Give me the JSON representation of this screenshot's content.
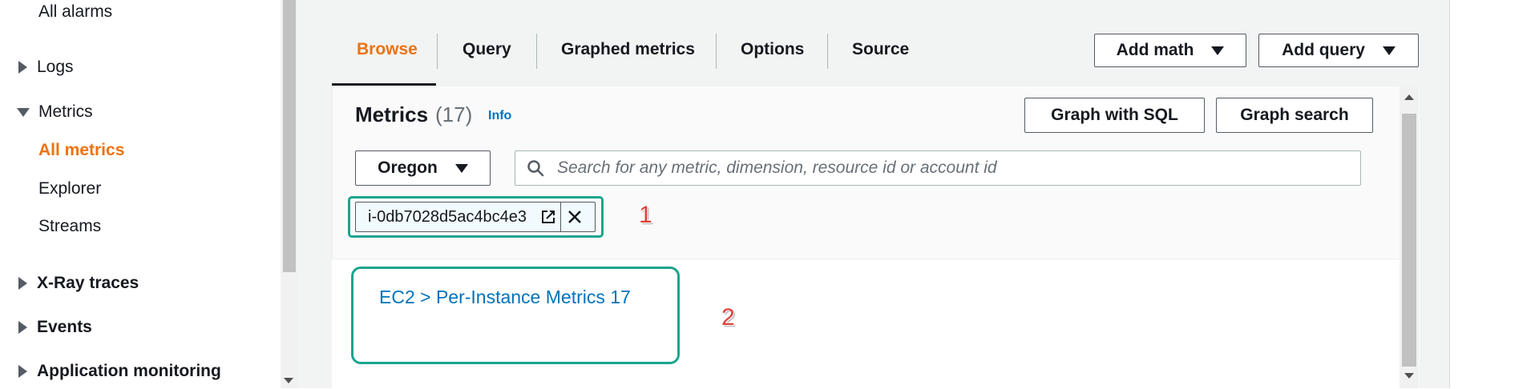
{
  "sidebar": {
    "all_alarms": "All alarms",
    "logs": "Logs",
    "metrics": "Metrics",
    "all_metrics": "All metrics",
    "explorer": "Explorer",
    "streams": "Streams",
    "xray": "X-Ray traces",
    "events": "Events",
    "app_monitoring": "Application monitoring"
  },
  "tabs": {
    "browse": "Browse",
    "query": "Query",
    "graphed": "Graphed metrics",
    "options": "Options",
    "source": "Source"
  },
  "toolbar": {
    "add_math": "Add math",
    "add_query": "Add query"
  },
  "metrics_panel": {
    "title": "Metrics",
    "count": "(17)",
    "info": "Info",
    "graph_sql": "Graph with SQL",
    "graph_search": "Graph search",
    "region": "Oregon",
    "search_placeholder": "Search for any metric, dimension, resource id or account id",
    "token": "i-0db7028d5ac4bc4e3",
    "result": "EC2 > Per-Instance Metrics 17"
  },
  "annotations": {
    "one": "1",
    "two": "2"
  },
  "colors": {
    "accent": "#ec7211",
    "link": "#0073bb",
    "highlight": "#1aa58f",
    "annotation": "#e0403a"
  }
}
